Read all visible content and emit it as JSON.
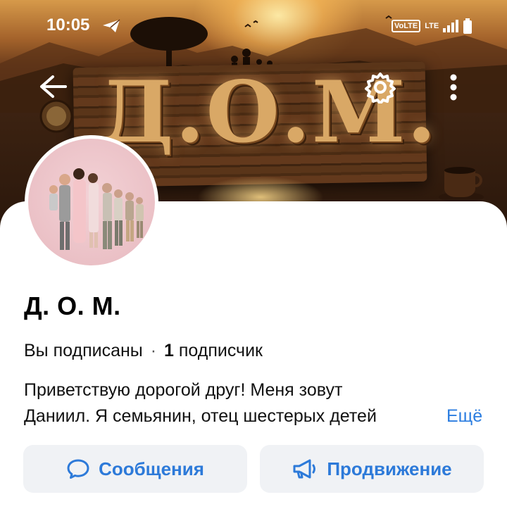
{
  "status_bar": {
    "time": "10:05",
    "network_volte": "VoLTE",
    "network_lte": "LTE"
  },
  "cover": {
    "title": "Д.О.М."
  },
  "profile": {
    "name": "Д. О. М.",
    "subscription_status": "Вы подписаны",
    "separator": "·",
    "subscriber_count": "1",
    "subscriber_label": "подписчик",
    "about_line1": "Приветствую дорогой друг! Меня зовут",
    "about_line2": "Даниил. Я семьянин, отец шестерых детей",
    "more_link": "Ещё"
  },
  "actions": {
    "messages_label": "Сообщения",
    "promo_label": "Продвижение"
  },
  "colors": {
    "accent": "#2d7ad9",
    "button_bg": "#f0f2f5"
  }
}
